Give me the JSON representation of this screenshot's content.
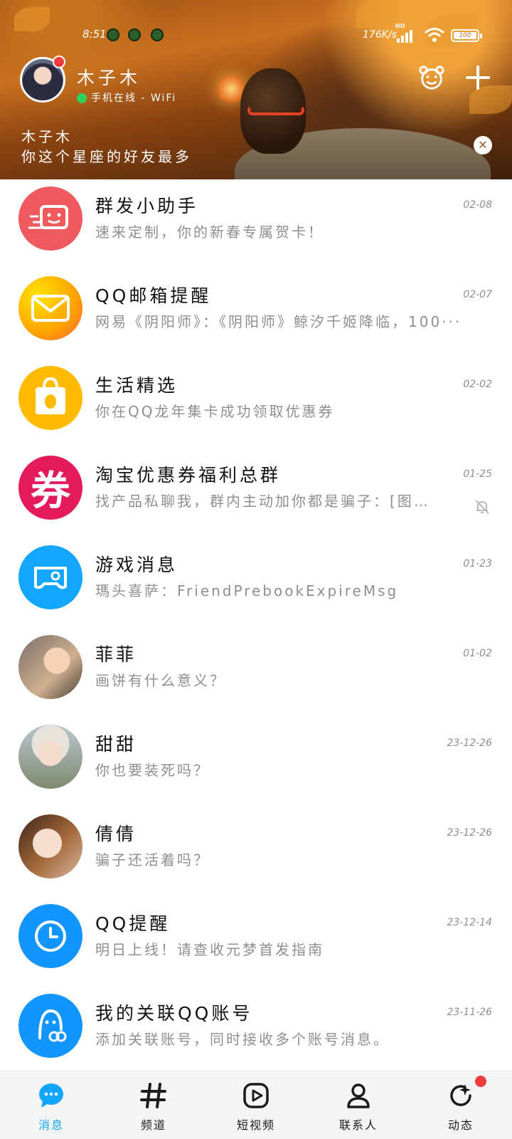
{
  "status_bar": {
    "time": "8:51",
    "speed": "176K/s",
    "network_badge": "HD",
    "battery": "100",
    "battery_level_percent": 100
  },
  "profile": {
    "name": "木子木",
    "online_status": "手机在线 - WiFi"
  },
  "banner": {
    "title": "木子木",
    "text": "你这个星座的好友最多",
    "close_glyph": "✕"
  },
  "conversations": [
    {
      "name": "群发小助手",
      "preview": "速来定制，你的新春专属贺卡！",
      "time": "02-08",
      "avatar_icon": "card-icon",
      "muted": false
    },
    {
      "name": "QQ邮箱提醒",
      "preview": "网易《阴阳师》：《阴阳师》鲸汐千姬降临，100···",
      "time": "02-07",
      "avatar_icon": "mail-icon",
      "muted": false
    },
    {
      "name": "生活精选",
      "preview": "你在QQ龙年集卡成功领取优惠券",
      "time": "02-02",
      "avatar_icon": "shopping-bag-icon",
      "muted": false
    },
    {
      "name": "淘宝优惠券福利总群",
      "preview": "找产品私聊我，群内主动加你都是骗子：[图···",
      "time": "01-25",
      "avatar_icon": "coupon-icon",
      "avatar_text": "券",
      "muted": true
    },
    {
      "name": "游戏消息",
      "preview": "瑪头喜萨：FriendPrebookExpireMsg",
      "time": "01-23",
      "avatar_icon": "gamepad-icon",
      "muted": false
    },
    {
      "name": "菲菲",
      "preview": "画饼有什么意义？",
      "time": "01-02",
      "avatar_icon": "user-photo",
      "muted": false
    },
    {
      "name": "甜甜",
      "preview": "你也要装死吗？",
      "time": "23-12-26",
      "avatar_icon": "user-photo",
      "muted": false
    },
    {
      "name": "倩倩",
      "preview": "骗子还活着吗？",
      "time": "23-12-26",
      "avatar_icon": "user-photo",
      "muted": false
    },
    {
      "name": "QQ提醒",
      "preview": "明日上线！请查收元梦首发指南",
      "time": "23-12-14",
      "avatar_icon": "clock-icon",
      "muted": false
    },
    {
      "name": "我的关联QQ账号",
      "preview": "添加关联账号，同时接收多个账号消息。",
      "time": "23-11-26",
      "avatar_icon": "linked-account-icon",
      "muted": false
    }
  ],
  "tabs": [
    {
      "label": "消息",
      "icon": "chat-bubble-icon",
      "active": true
    },
    {
      "label": "频道",
      "icon": "hashtag-icon",
      "active": false
    },
    {
      "label": "短视频",
      "icon": "video-play-icon",
      "active": false
    },
    {
      "label": "联系人",
      "icon": "person-icon",
      "active": false
    },
    {
      "label": "动态",
      "icon": "refresh-star-icon",
      "active": false,
      "badge": true
    }
  ],
  "colors": {
    "accent": "#12a6ff",
    "online": "#2fd05f",
    "badge": "#f23c3c",
    "muted_text": "#8e8e93"
  }
}
